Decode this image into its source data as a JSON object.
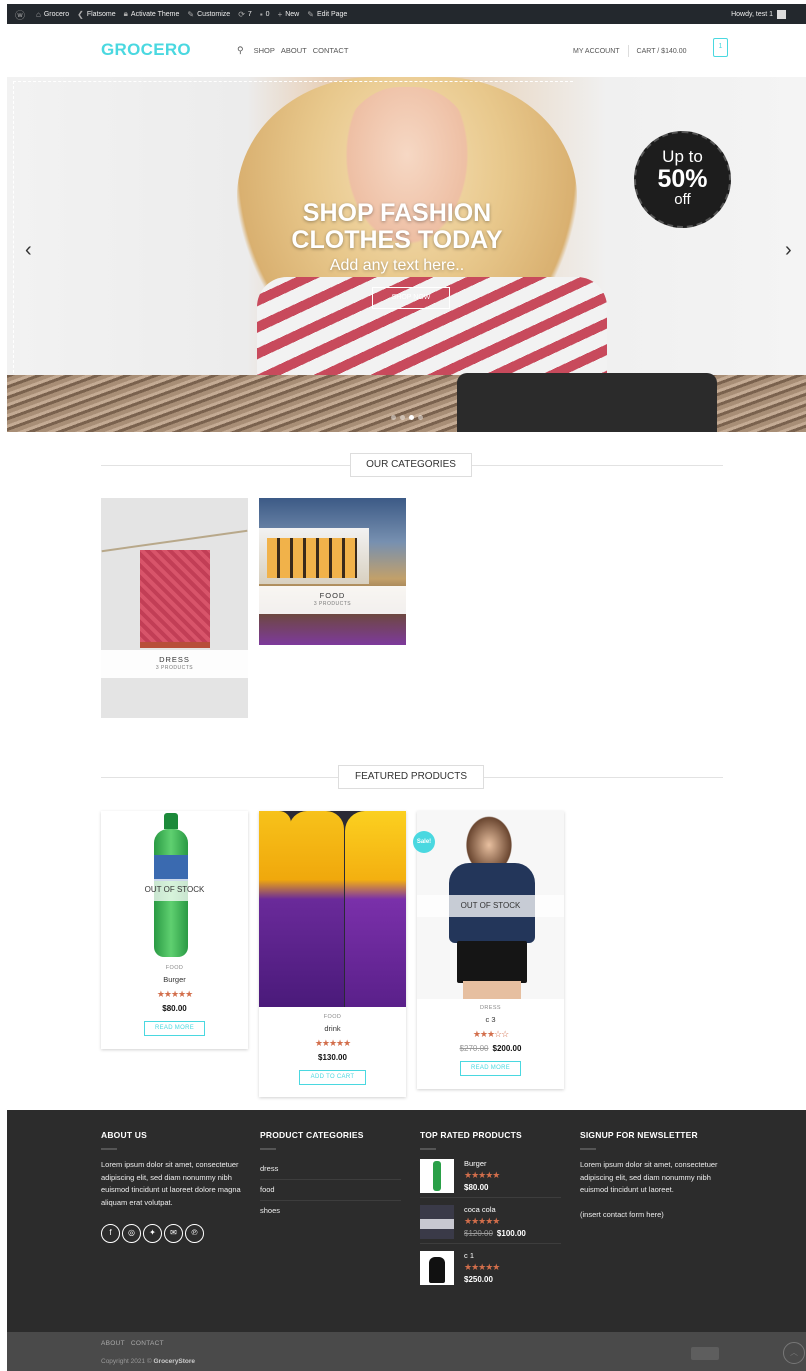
{
  "admin_bar": {
    "site_name": "Grocero",
    "theme_name": "Flatsome",
    "activate_theme": "Activate Theme",
    "customize": "Customize",
    "updates": "7",
    "comments": "0",
    "new": "New",
    "edit_page": "Edit Page",
    "howdy": "Howdy, test 1"
  },
  "header": {
    "logo": "GROCERO",
    "nav": [
      "SHOP",
      "ABOUT",
      "CONTACT"
    ],
    "my_account": "MY ACCOUNT",
    "cart": "CART / $140.00",
    "cart_count": "1"
  },
  "hero": {
    "title": "SHOP FASHION CLOTHES TODAY",
    "subtitle": "Add any text here..",
    "button": "SHOP NOW",
    "badge_top": "Up to",
    "badge_value": "50%",
    "badge_bottom": "off"
  },
  "categories": {
    "title": "OUR CATEGORIES",
    "items": [
      {
        "name": "DRESS",
        "count": "3 PRODUCTS"
      },
      {
        "name": "FOOD",
        "count": "3 PRODUCTS"
      }
    ]
  },
  "featured": {
    "title": "FEATURED PRODUCTS",
    "products": [
      {
        "category": "FOOD",
        "name": "Burger",
        "stars": "★★★★★",
        "price": "$80.00",
        "old_price": "",
        "button": "READ MORE",
        "status": "OUT OF STOCK",
        "sale": ""
      },
      {
        "category": "FOOD",
        "name": "drink",
        "stars": "★★★★★",
        "price": "$130.00",
        "old_price": "",
        "button": "ADD TO CART",
        "status": "",
        "sale": ""
      },
      {
        "category": "DRESS",
        "name": "c 3",
        "stars": "★★★☆☆",
        "price": "$200.00",
        "old_price": "$270.00",
        "button": "READ MORE",
        "status": "OUT OF STOCK",
        "sale": "Sale!"
      }
    ]
  },
  "footer": {
    "about_title": "ABOUT US",
    "about_text": "Lorem ipsum dolor sit amet, consectetuer adipiscing elit, sed diam nonummy nibh euismod tincidunt ut laoreet dolore magna aliquam erat volutpat.",
    "categories_title": "PRODUCT CATEGORIES",
    "categories": [
      "dress",
      "food",
      "shoes"
    ],
    "top_rated_title": "TOP RATED PRODUCTS",
    "top_rated": [
      {
        "name": "Burger",
        "stars": "★★★★★",
        "price": "$80.00",
        "old_price": ""
      },
      {
        "name": "coca cola",
        "stars": "★★★★★",
        "price": "$100.00",
        "old_price": "$120.00"
      },
      {
        "name": "c 1",
        "stars": "★★★★★",
        "price": "$250.00",
        "old_price": ""
      }
    ],
    "newsletter_title": "SIGNUP FOR NEWSLETTER",
    "newsletter_text": "Lorem ipsum dolor sit amet, consectetuer adipiscing elit, sed diam nonummy nibh euismod tincidunt ut laoreet.",
    "newsletter_form": "(insert contact form here)"
  },
  "bottom": {
    "links": [
      "ABOUT",
      "CONTACT"
    ],
    "copyright_prefix": "Copyright 2021 ©",
    "copyright_brand": "GroceryStore"
  },
  "colors": {
    "accent": "#4ad8e0",
    "star": "#d26e4b",
    "footer_bg": "#2c2c2c",
    "adminbar_bg": "#23282d"
  }
}
